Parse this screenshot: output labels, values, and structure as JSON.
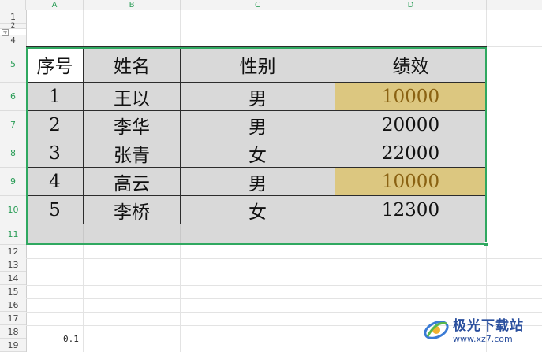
{
  "columns": [
    "A",
    "B",
    "C",
    "D"
  ],
  "rows": [
    "1",
    "2",
    "4",
    "5",
    "6",
    "7",
    "8",
    "9",
    "10",
    "11",
    "12",
    "13",
    "14",
    "15",
    "16",
    "17",
    "18",
    "19"
  ],
  "table": {
    "header": [
      "序号",
      "姓名",
      "性别",
      "绩效"
    ],
    "rows": [
      [
        "1",
        "王以",
        "男",
        "10000"
      ],
      [
        "2",
        "李华",
        "男",
        "20000"
      ],
      [
        "3",
        "张青",
        "女",
        "22000"
      ],
      [
        "4",
        "高云",
        "男",
        "10000"
      ],
      [
        "5",
        "李桥",
        "女",
        "12300"
      ]
    ],
    "highlighted_rows": [
      0,
      3
    ],
    "highlight_color": "#dcc780",
    "highlight_text_color": "#8a6212",
    "fill_color": "#d9d9d9"
  },
  "stray_cell": "0.1",
  "outline_toggle": "÷",
  "watermark": {
    "title": "极光下载站",
    "url": "www.xz7.com"
  },
  "accent_color": "#2fa860"
}
